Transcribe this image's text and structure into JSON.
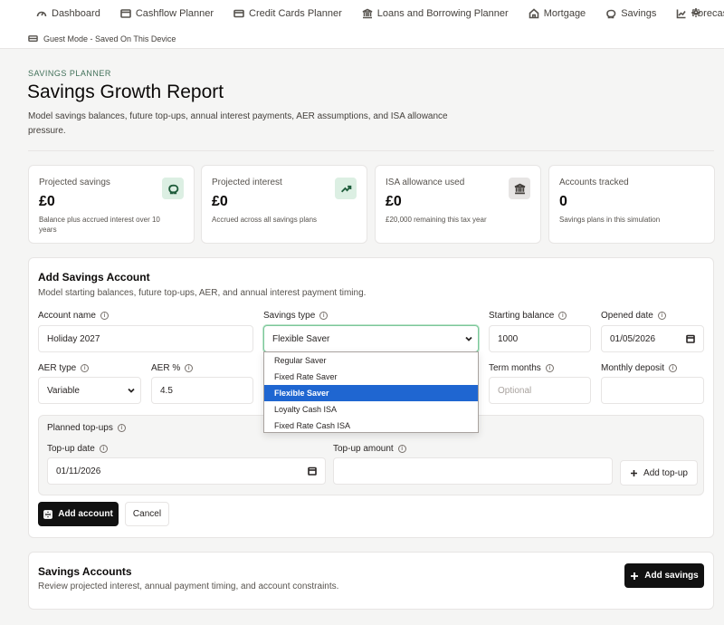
{
  "nav": {
    "items": [
      {
        "label": "Dashboard",
        "icon": "gauge-icon"
      },
      {
        "label": "Cashflow Planner",
        "icon": "wallet-icon"
      },
      {
        "label": "Credit Cards Planner",
        "icon": "credit-card-icon"
      },
      {
        "label": "Loans and Borrowing Planner",
        "icon": "bank-icon"
      },
      {
        "label": "Mortgage",
        "icon": "home-icon"
      },
      {
        "label": "Savings",
        "icon": "piggy-bank-icon"
      },
      {
        "label": "Forecast",
        "icon": "chart-line-icon"
      }
    ],
    "settings_icon": "gear-icon",
    "guest_mode": "Guest Mode - Saved On This Device"
  },
  "header": {
    "kicker": "SAVINGS PLANNER",
    "title": "Savings Growth Report",
    "description": "Model savings balances, future top-ups, annual interest payments, AER assumptions, and ISA allowance pressure."
  },
  "stats": [
    {
      "label": "Projected savings",
      "value": "£0",
      "sub": "Balance plus accrued interest over 10 years",
      "icon": "piggy-bank-icon"
    },
    {
      "label": "Projected interest",
      "value": "£0",
      "sub": "Accrued across all savings plans",
      "icon": "trending-up-icon"
    },
    {
      "label": "ISA allowance used",
      "value": "£0",
      "sub": "£20,000 remaining this tax year",
      "icon": "bank-icon"
    },
    {
      "label": "Accounts tracked",
      "value": "0",
      "sub": "Savings plans in this simulation"
    }
  ],
  "form": {
    "title": "Add Savings Account",
    "description": "Model starting balances, future top-ups, AER, and annual interest payment timing.",
    "account_name": {
      "label": "Account name",
      "value": "Holiday 2027"
    },
    "savings_type": {
      "label": "Savings type",
      "value": "Flexible Saver",
      "options": [
        "Regular Saver",
        "Fixed Rate Saver",
        "Flexible Saver",
        "Loyalty Cash ISA",
        "Fixed Rate Cash ISA"
      ]
    },
    "starting_balance": {
      "label": "Starting balance",
      "value": "1000"
    },
    "opened_date": {
      "label": "Opened date",
      "value": "01/05/2026"
    },
    "aer_type": {
      "label": "AER type",
      "value": "Variable"
    },
    "aer_pct": {
      "label": "AER %",
      "value": "4.5"
    },
    "term_months": {
      "label": "Term months",
      "placeholder": "Optional"
    },
    "monthly_deposit": {
      "label": "Monthly deposit",
      "value": ""
    },
    "topups": {
      "label": "Planned top-ups",
      "date_label": "Top-up date",
      "date_value": "01/11/2026",
      "amount_label": "Top-up amount",
      "amount_value": "",
      "add_label": "Add top-up"
    },
    "submit_label": "Add account",
    "cancel_label": "Cancel"
  },
  "accounts": {
    "title": "Savings Accounts",
    "description": "Review projected interest, annual payment timing, and account constraints.",
    "add_label": "Add savings"
  }
}
